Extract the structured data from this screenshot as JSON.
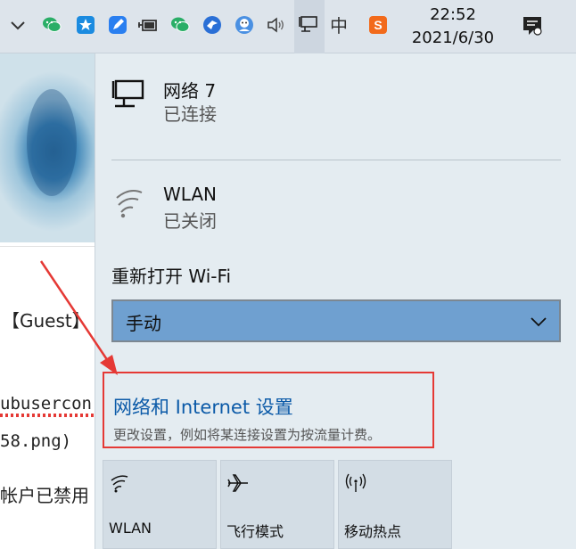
{
  "taskbar": {
    "tray_icons": [
      {
        "name": "chevron-up-icon"
      },
      {
        "name": "wechat-icon"
      },
      {
        "name": "app-star-icon"
      },
      {
        "name": "pencil-app-icon"
      },
      {
        "name": "battery-plug-icon"
      },
      {
        "name": "wechat-alt-icon"
      },
      {
        "name": "bird-icon"
      },
      {
        "name": "avatar-app-icon"
      },
      {
        "name": "volume-icon"
      },
      {
        "name": "network-icon"
      }
    ],
    "ime": "中",
    "clock_time": "22:52",
    "clock_date": "2021/6/30"
  },
  "background": {
    "lines": [
      "【Guest】",
      "ubusercon",
      "58.png)",
      "帐户已禁用"
    ]
  },
  "flyout": {
    "networks": [
      {
        "name": "网络 7",
        "status": "已连接",
        "icon": "ethernet-icon"
      },
      {
        "name": "WLAN",
        "status": "已关闭",
        "icon": "wifi-icon"
      }
    ],
    "wifi_reenable_label": "重新打开 Wi-Fi",
    "wifi_reenable_value": "手动",
    "settings_link": "网络和 Internet 设置",
    "settings_desc": "更改设置，例如将某连接设置为按流量计费。",
    "quick_actions": [
      {
        "label": "WLAN",
        "icon": "wifi-icon"
      },
      {
        "label": "飞行模式",
        "icon": "airplane-icon"
      },
      {
        "label": "移动热点",
        "icon": "hotspot-icon"
      }
    ]
  },
  "colors": {
    "accent": "#0b5aa8",
    "dropdown": "#6fa0d0",
    "highlight_box": "#e53935"
  }
}
